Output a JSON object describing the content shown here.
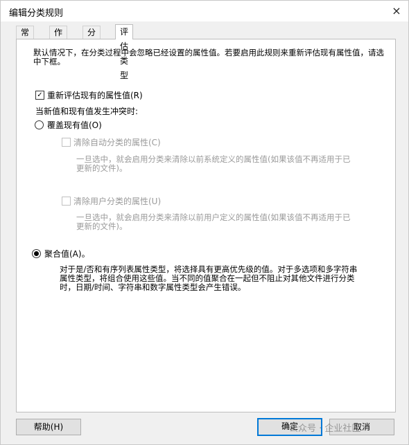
{
  "window": {
    "title": "编辑分类规则",
    "close_icon": "×"
  },
  "tabs": [
    {
      "label": "常规"
    },
    {
      "label": "作用域"
    },
    {
      "label": "分类"
    },
    {
      "label": "评估类型",
      "active": true
    }
  ],
  "panel": {
    "intro": "默认情况下，在分类过程中会忽略已经设置的属性值。若要启用此规则来重新评估现有属性值，请选中下框。",
    "reevaluate": {
      "label": "重新评估现有的属性值(R)",
      "checked": true
    },
    "conflict_label": "当新值和现有值发生冲突时:",
    "overwrite": {
      "label": "覆盖现有值(O)",
      "selected": false,
      "clear_auto": {
        "label": "清除自动分类的属性(C)",
        "checked": false,
        "disabled": true,
        "desc": "一旦选中，就会启用分类来清除以前系统定义的属性值(如果该值不再适用于已更新的文件)。"
      },
      "clear_user": {
        "label": "清除用户分类的属性(U)",
        "checked": false,
        "disabled": true,
        "desc": "一旦选中，就会启用分类来清除以前用户定义的属性值(如果该值不再适用于已更新的文件)。"
      }
    },
    "aggregate": {
      "label": "聚合值(A)。",
      "selected": true,
      "desc": "对于是/否和有序列表属性类型，将选择具有更高优先级的值。对于多选项和多字符串属性类型，将组合使用这些值。当不同的值聚合在一起但不阻止对其他文件进行分类时，日期/时间、字符串和数字属性类型会产生错误。"
    }
  },
  "buttons": {
    "help": "帮助(H)",
    "ok": "确定",
    "cancel": "取消"
  },
  "watermark": "公众号 · 企业社区"
}
